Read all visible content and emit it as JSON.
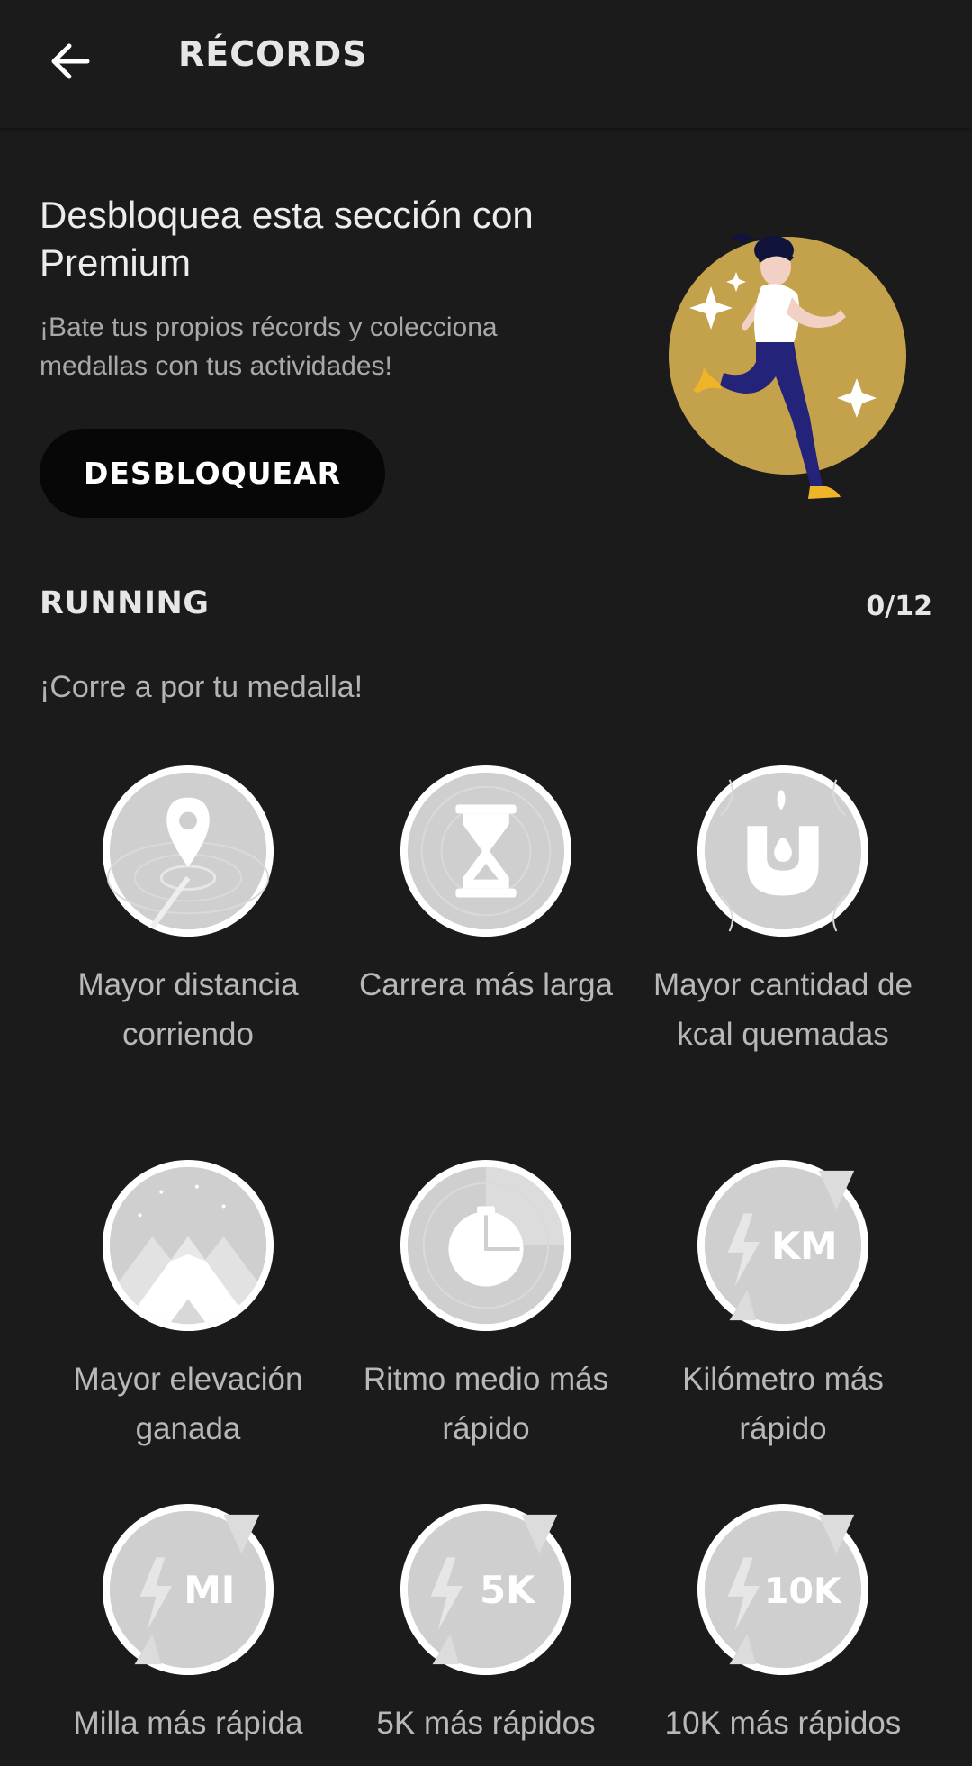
{
  "header": {
    "title": "RÉCORDS",
    "back_icon": "arrow-left-icon"
  },
  "promo": {
    "title": "Desbloquea esta sección con Premium",
    "subtitle": "¡Bate tus propios récords y colecciona medallas con tus actividades!",
    "button_label": "DESBLOQUEAR",
    "illustration": "running-woman-illustration",
    "accent_color": "#c4a24c"
  },
  "section": {
    "title": "RUNNING",
    "count": "0/12",
    "subtitle": "¡Corre a por tu medalla!"
  },
  "medals": [
    {
      "label": "Mayor distancia corriendo",
      "icon": "location-pin-icon"
    },
    {
      "label": "Carrera más larga",
      "icon": "hourglass-icon"
    },
    {
      "label": "Mayor cantidad de kcal quemadas",
      "icon": "flame-icon"
    },
    {
      "label": "Mayor elevación ganada",
      "icon": "mountain-icon"
    },
    {
      "label": "Ritmo medio más rápido",
      "icon": "stopwatch-icon"
    },
    {
      "label": "Kilómetro más rápido",
      "icon": "lightning-icon",
      "badge_text": "KM"
    },
    {
      "label": "Milla más rápida",
      "icon": "lightning-icon",
      "badge_text": "MI"
    },
    {
      "label": "5K más rápidos",
      "icon": "lightning-icon",
      "badge_text": "5K"
    },
    {
      "label": "10K más rápidos",
      "icon": "lightning-icon",
      "badge_text": "10K"
    }
  ]
}
